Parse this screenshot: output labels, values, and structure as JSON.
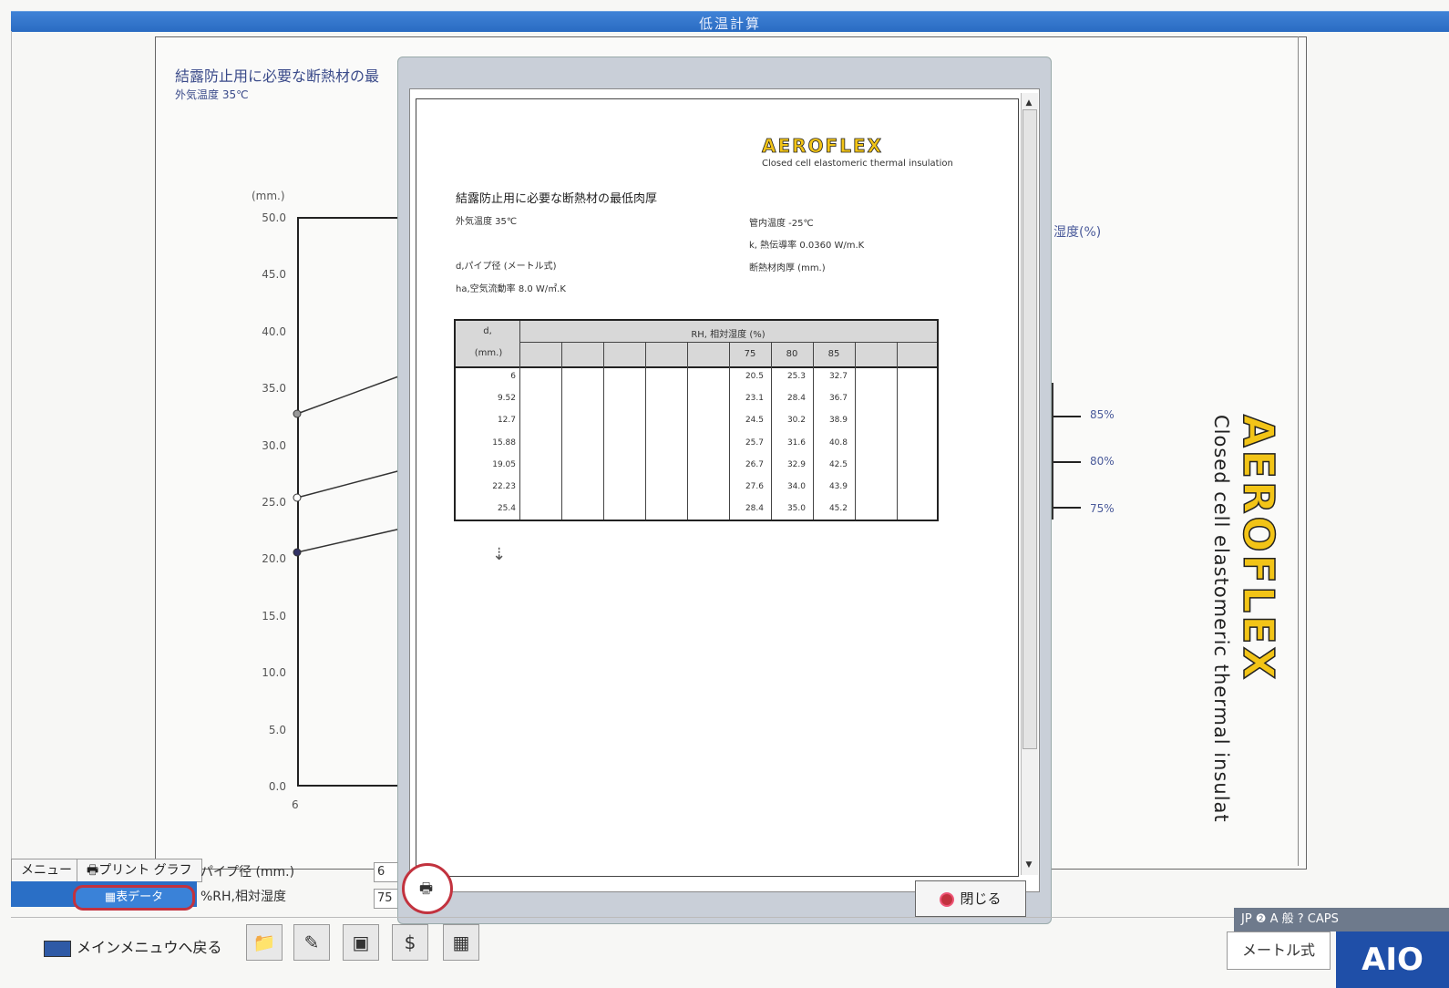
{
  "window": {
    "title": "低温計算"
  },
  "background_chart": {
    "title": "結露防止用に必要な断熱材の最",
    "subtitle": "外気温度 35℃",
    "y_unit": "(mm.)",
    "y_ticks": [
      "50.0",
      "45.0",
      "40.0",
      "35.0",
      "30.0",
      "25.0",
      "20.0",
      "15.0",
      "10.0",
      "5.0",
      "0.0"
    ],
    "x_start": "6",
    "humidity_label": "湿度(%)",
    "pct_labels": [
      "85%",
      "80%",
      "75%"
    ]
  },
  "brand": {
    "logo": "AEROFLEX",
    "tagline": "Closed cell elastomeric thermal insulat"
  },
  "controls": {
    "menu_tab": "メニュー",
    "print_tab": "🖶プリント グラフ",
    "table_data_btn": "▦表データ",
    "pipe_label": "パイプ径 (mm.)",
    "pipe_value": "6",
    "rh_label": "%RH,相対湿度",
    "rh_value": "75"
  },
  "modal": {
    "logo": "AEROFLEX",
    "logo_tagline": "Closed cell elastomeric thermal insulation",
    "doc_title": "結露防止用に必要な断熱材の最低肉厚",
    "outside_temp": "外気温度 35℃",
    "inside_temp": "管内温度 -25℃",
    "k_value": "k, 熱伝導率 0.0360 W/m.K",
    "pipe_dia": "d,パイプ径 (メートル式)",
    "thickness": "断熱材肉厚 (mm.)",
    "ha": "ha,空気流動率 8.0 W/㎡.K",
    "table": {
      "d_header": "d,",
      "d_unit": "(mm.)",
      "rh_header": "RH, 相対湿度 (%)",
      "rh_cols": [
        "75",
        "80",
        "85"
      ],
      "rows": [
        {
          "d": "6",
          "v": [
            "20.5",
            "25.3",
            "32.7"
          ]
        },
        {
          "d": "9.52",
          "v": [
            "23.1",
            "28.4",
            "36.7"
          ]
        },
        {
          "d": "12.7",
          "v": [
            "24.5",
            "30.2",
            "38.9"
          ]
        },
        {
          "d": "15.88",
          "v": [
            "25.7",
            "31.6",
            "40.8"
          ]
        },
        {
          "d": "19.05",
          "v": [
            "26.7",
            "32.9",
            "42.5"
          ]
        },
        {
          "d": "22.23",
          "v": [
            "27.6",
            "34.0",
            "43.9"
          ]
        },
        {
          "d": "25.4",
          "v": [
            "28.4",
            "35.0",
            "45.2"
          ]
        }
      ]
    },
    "close_label": "閉じる"
  },
  "bottom": {
    "back_label": "メインメニュウへ戻る",
    "tray_text": "JP ❷ A 般 ? CAPS",
    "metric_label": "メートル式",
    "aio_logo": "AIO"
  }
}
